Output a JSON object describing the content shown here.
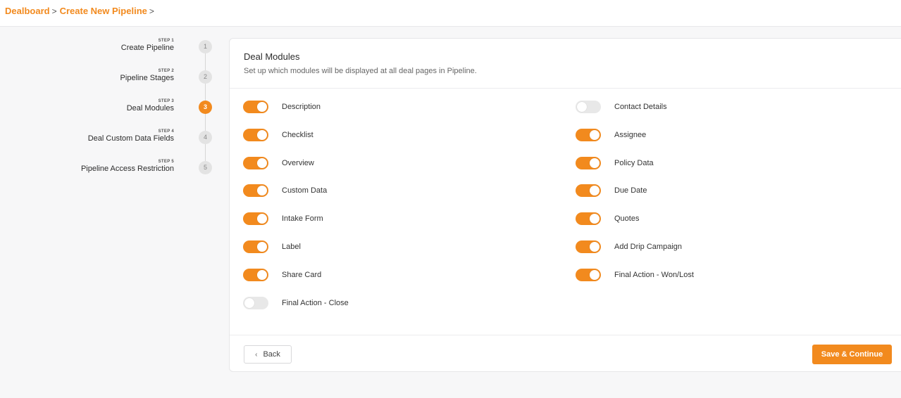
{
  "breadcrumb": {
    "items": [
      "Dealboard",
      "Create New Pipeline"
    ],
    "separator": ">"
  },
  "stepper": {
    "steps": [
      {
        "small": "STEP 1",
        "title": "Create Pipeline",
        "number": "1"
      },
      {
        "small": "STEP 2",
        "title": "Pipeline Stages",
        "number": "2"
      },
      {
        "small": "STEP 3",
        "title": "Deal Modules",
        "number": "3"
      },
      {
        "small": "STEP 4",
        "title": "Deal Custom Data Fields",
        "number": "4"
      },
      {
        "small": "STEP 5",
        "title": "Pipeline Access Restriction",
        "number": "5"
      }
    ],
    "active_step": 3
  },
  "card": {
    "title": "Deal Modules",
    "subtitle": "Set up which modules will be displayed at all deal pages in Pipeline.",
    "modules_left": [
      {
        "label": "Description",
        "on": true
      },
      {
        "label": "Checklist",
        "on": true
      },
      {
        "label": "Overview",
        "on": true
      },
      {
        "label": "Custom Data",
        "on": true
      },
      {
        "label": "Intake Form",
        "on": true
      },
      {
        "label": "Label",
        "on": true
      },
      {
        "label": "Share Card",
        "on": true
      },
      {
        "label": "Final Action - Close",
        "on": false
      }
    ],
    "modules_right": [
      {
        "label": "Contact Details",
        "on": false
      },
      {
        "label": "Assignee",
        "on": true
      },
      {
        "label": "Policy Data",
        "on": true
      },
      {
        "label": "Due Date",
        "on": true
      },
      {
        "label": "Quotes",
        "on": true
      },
      {
        "label": "Add Drip Campaign",
        "on": true
      },
      {
        "label": "Final Action - Won/Lost",
        "on": true
      }
    ]
  },
  "footer": {
    "back_label": "Back",
    "back_icon": "chevron-left-icon",
    "save_label": "Save & Continue"
  },
  "colors": {
    "accent": "#f28a1e",
    "toggle_off": "#e8e8e8"
  }
}
